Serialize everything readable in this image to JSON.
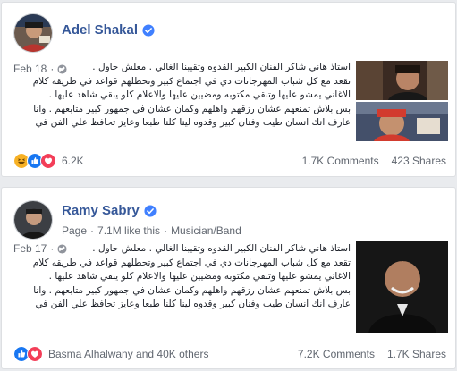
{
  "posts": [
    {
      "author": "Adel Shakal",
      "date": "Feb 18",
      "lines": [
        "استاذ هاني شاكر الفنان الكبير القدوه وتقيبنا الغالي . معلش حاول .",
        "تقعد مع كل شباب المهرجانات دي في اجتماع كبير وتحطلهم قواعد في طريقه كلام",
        "الاغاني يمشو عليها وتبقي مكتوبه ومضيين عليها والاعلام كلو يبقي شاهد عليها .",
        "بس بلاش تمنعهم عشان رزقهم واهلهم وكمان عشان في جمهور كبير متابعهم . وانا",
        "عارف انك انسان طيب وفنان كبير وقدوه لينا كلنا طبعا وعايز تحافظ علي الفن في"
      ],
      "reactions_count": "6.2K",
      "comments": "1.7K Comments",
      "shares": "423 Shares"
    },
    {
      "author": "Ramy Sabry",
      "subtitle_page": "Page",
      "subtitle_likes": "7.1M like this",
      "subtitle_category": "Musician/Band",
      "date": "Feb 17",
      "lines": [
        "استاذ هاني شاكر الفنان الكبير القدوه وتقيبنا الغالي . معلش حاول .",
        "تقعد مع كل شباب المهرجانات دي في اجتماع كبير وتحطلهم قواعد في طريقه كلام",
        "الاغاني يمشو عليها وتبقي مكتوبه ومضيين عليها والاعلام كلو يبقي شاهد عليها .",
        "بس بلاش تمنعهم عشان رزقهم واهلهم وكمان عشان في جمهور كبير متابعهم . وانا",
        "عارف انك انسان طيب وفنان كبير وقدوه لينا كلنا طبعا وعايز تحافظ علي الفن في"
      ],
      "reactions_text": "Basma Alhalwany and 40K others",
      "comments": "7.2K Comments",
      "shares": "1.7K Shares"
    }
  ],
  "icons": {
    "verified": "verified-badge-icon",
    "privacy": "globe-icon",
    "reactions_post1": [
      "haha-icon",
      "like-icon",
      "love-icon"
    ],
    "reactions_post2": [
      "like-icon",
      "love-icon"
    ]
  },
  "colors": {
    "author_link": "#365899",
    "meta_gray": "#616770",
    "like_blue": "#1877f2",
    "love_red": "#f33e58",
    "haha_yellow": "#f7b125"
  }
}
